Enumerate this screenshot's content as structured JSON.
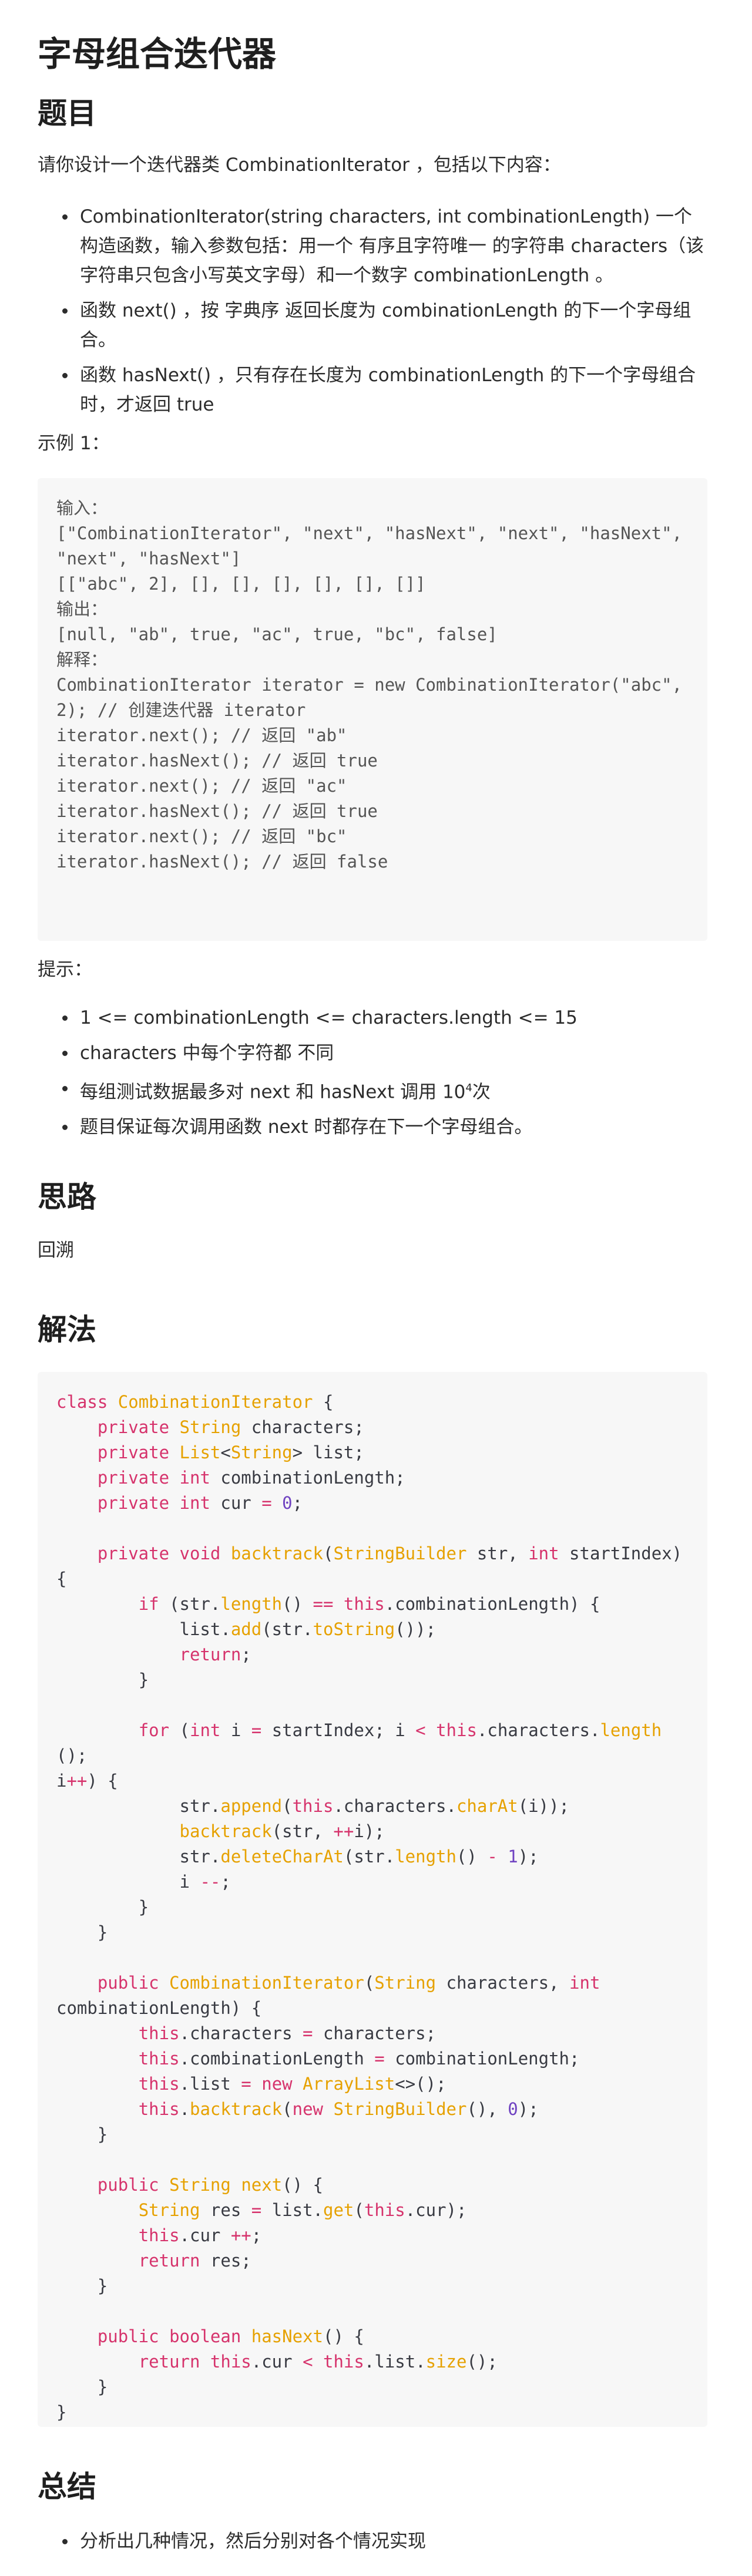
{
  "title": "字母组合迭代器",
  "sections": {
    "problem": "题目",
    "idea": "思路",
    "solution": "解法",
    "summary": "总结"
  },
  "intro": "请你设计一个迭代器类 CombinationIterator ，包括以下内容：",
  "requirements": [
    "CombinationIterator(string characters, int combinationLength) 一个构造函数，输入参数包括：用一个 有序且字符唯一 的字符串 characters（该字符串只包含小写英文字母）和一个数字 combinationLength 。",
    "函数 next() ，按 字典序 返回长度为 combinationLength 的下一个字母组合。",
    "函数 hasNext() ，只有存在长度为 combinationLength 的下一个字母组合时，才返回 true"
  ],
  "example_label": "示例 1：",
  "example_lines": [
    "输入：",
    "[\"CombinationIterator\", \"next\", \"hasNext\", \"next\", \"hasNext\", \"next\", \"hasNext\"]",
    "[[\"abc\", 2], [], [], [], [], [], []]",
    "输出：",
    "[null, \"ab\", true, \"ac\", true, \"bc\", false]",
    "解释：",
    "CombinationIterator iterator = new CombinationIterator(\"abc\", 2); // 创建迭代器 iterator",
    "iterator.next(); // 返回 \"ab\"",
    "iterator.hasNext(); // 返回 true",
    "iterator.next(); // 返回 \"ac\"",
    "iterator.hasNext(); // 返回 true",
    "iterator.next(); // 返回 \"bc\"",
    "iterator.hasNext(); // 返回 false"
  ],
  "hint_label": "提示：",
  "hints": [
    "1 <= combinationLength <= characters.length <= 15",
    "characters 中每个字符都 不同",
    "每组测试数据最多对 next 和 hasNext 调用 10",
    "题目保证每次调用函数 next 时都存在下一个字母组合。"
  ],
  "hint_sup": "4",
  "hint_suffix": "次",
  "idea_text": "回溯",
  "summary_items": [
    "分析出几种情况，然后分别对各个情况实现"
  ]
}
